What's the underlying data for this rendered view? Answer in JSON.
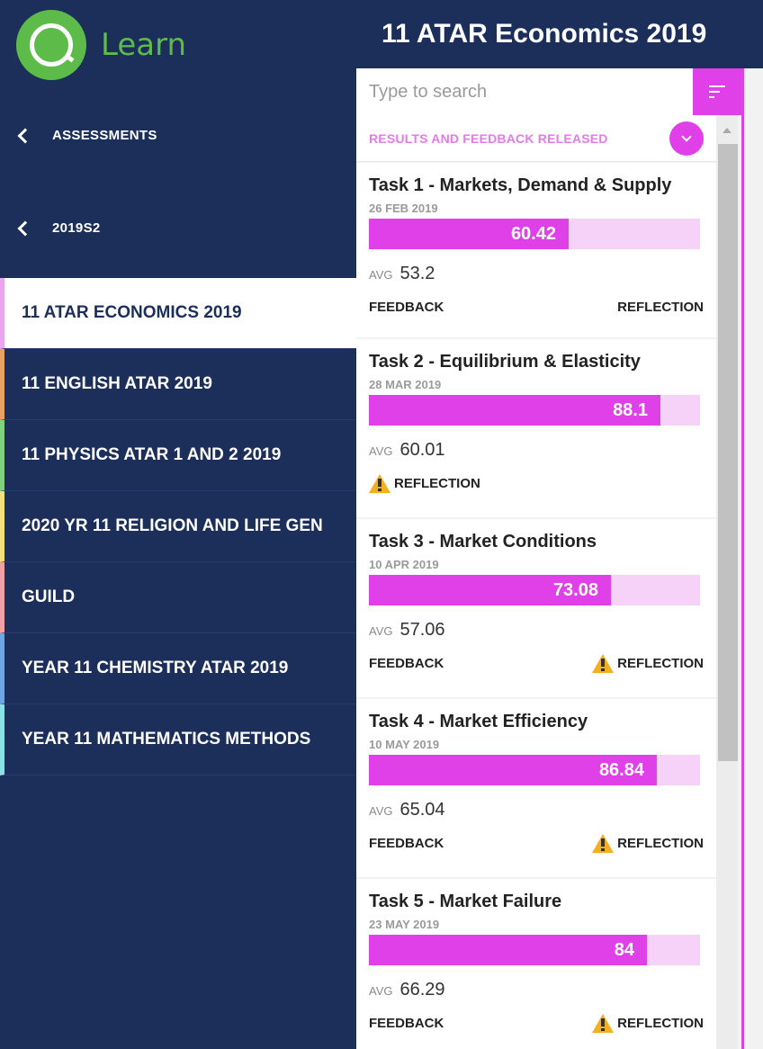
{
  "brand": {
    "name": "Learn",
    "color": "#5dbb4a"
  },
  "colors": {
    "navy": "#1c2e5a",
    "accent": "#e040e8",
    "accent_light": "#f6d2f9",
    "warning": "#f2b01e"
  },
  "sidebar": {
    "back_links": [
      {
        "label": "ASSESSMENTS",
        "icon": "chevron-left-icon"
      },
      {
        "label": "2019S2",
        "icon": "chevron-left-icon"
      }
    ],
    "courses": [
      {
        "label": "11 ATAR ECONOMICS 2019",
        "color": "#e6a7ee",
        "active": true
      },
      {
        "label": "11 ENGLISH ATAR 2019",
        "color": "#e8a160",
        "active": false
      },
      {
        "label": "11 PHYSICS ATAR 1 AND 2 2019",
        "color": "#7fd07f",
        "active": false
      },
      {
        "label": "2020 YR 11 RELIGION AND LIFE GEN",
        "color": "#f0e27a",
        "active": false
      },
      {
        "label": "GUILD",
        "color": "#f0a0a8",
        "active": false
      },
      {
        "label": "YEAR 11 CHEMISTRY ATAR 2019",
        "color": "#6ea5e6",
        "active": false
      },
      {
        "label": "YEAR 11 MATHEMATICS METHODS",
        "color": "#8fe0e6",
        "active": false
      }
    ]
  },
  "panel": {
    "title": "11 ATAR Economics 2019",
    "search": {
      "placeholder": "Type to search",
      "value": ""
    },
    "filter_icon": "filter-icon",
    "section_label": "RESULTS AND FEEDBACK RELEASED",
    "section_toggle_icon": "chevron-down-icon",
    "avg_label": "AVG",
    "tasks": [
      {
        "title": "Task 1 - Markets, Demand & Supply",
        "date": "26 FEB 2019",
        "score": "60.42",
        "score_fraction": 0.6042,
        "avg": "53.2",
        "feedback": "FEEDBACK",
        "reflection": "REFLECTION",
        "reflection_warning": false
      },
      {
        "title": "Task 2 - Equilibrium & Elasticity",
        "date": "28 MAR 2019",
        "score": "88.1",
        "score_fraction": 0.881,
        "avg": "60.01",
        "feedback": "",
        "reflection": "REFLECTION",
        "reflection_warning": true
      },
      {
        "title": "Task 3 - Market Conditions",
        "date": "10 APR 2019",
        "score": "73.08",
        "score_fraction": 0.7308,
        "avg": "57.06",
        "feedback": "FEEDBACK",
        "reflection": "REFLECTION",
        "reflection_warning": true
      },
      {
        "title": "Task 4 - Market Efficiency",
        "date": "10 MAY 2019",
        "score": "86.84",
        "score_fraction": 0.8684,
        "avg": "65.04",
        "feedback": "FEEDBACK",
        "reflection": "REFLECTION",
        "reflection_warning": true
      },
      {
        "title": "Task 5 - Market Failure",
        "date": "23 MAY 2019",
        "score": "84",
        "score_fraction": 0.84,
        "avg": "66.29",
        "feedback": "FEEDBACK",
        "reflection": "REFLECTION",
        "reflection_warning": true
      }
    ]
  }
}
